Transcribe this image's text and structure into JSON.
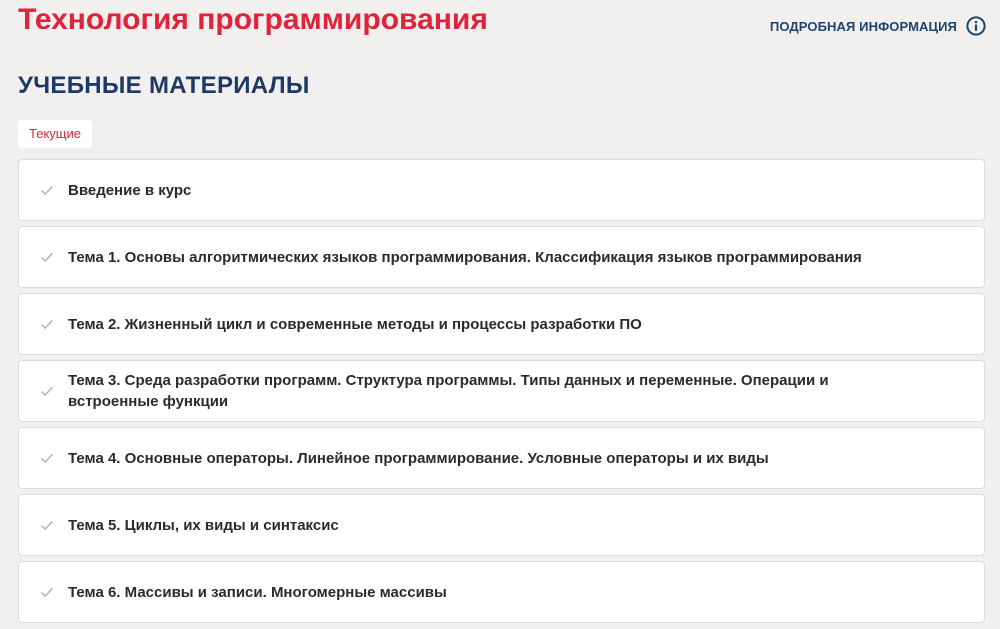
{
  "header": {
    "course_title": "Технология программирования",
    "info_link_label": "ПОДРОБНАЯ ИНФОРМАЦИЯ",
    "info_icon": "info-circle-icon"
  },
  "materials": {
    "heading": "УЧЕБНЫЕ МАТЕРИАЛЫ",
    "filter_tab_label": "Текущие",
    "items": [
      {
        "label": "Введение в курс",
        "icon": "check-icon"
      },
      {
        "label": "Тема 1. Основы алгоритмических языков программирования. Классификация языков программирования",
        "icon": "check-icon"
      },
      {
        "label": "Тема 2. Жизненный цикл и современные методы и процессы разработки ПО",
        "icon": "check-icon"
      },
      {
        "label": "Тема 3. Среда разработки программ. Структура программы. Типы данных и переменные. Операции и встроенные функции",
        "icon": "check-icon"
      },
      {
        "label": "Тема 4. Основные операторы. Линейное программирование. Условные операторы и их виды",
        "icon": "check-icon"
      },
      {
        "label": "Тема 5. Циклы, их виды и синтаксис",
        "icon": "check-icon"
      },
      {
        "label": "Тема 6. Массивы и записи. Многомерные массивы",
        "icon": "check-icon"
      }
    ]
  },
  "colors": {
    "accent_red": "#e0223a",
    "heading_blue": "#1d3a66",
    "link_blue": "#1d4470",
    "background": "#f2f0ef",
    "check_gray": "#b5b5b5"
  }
}
